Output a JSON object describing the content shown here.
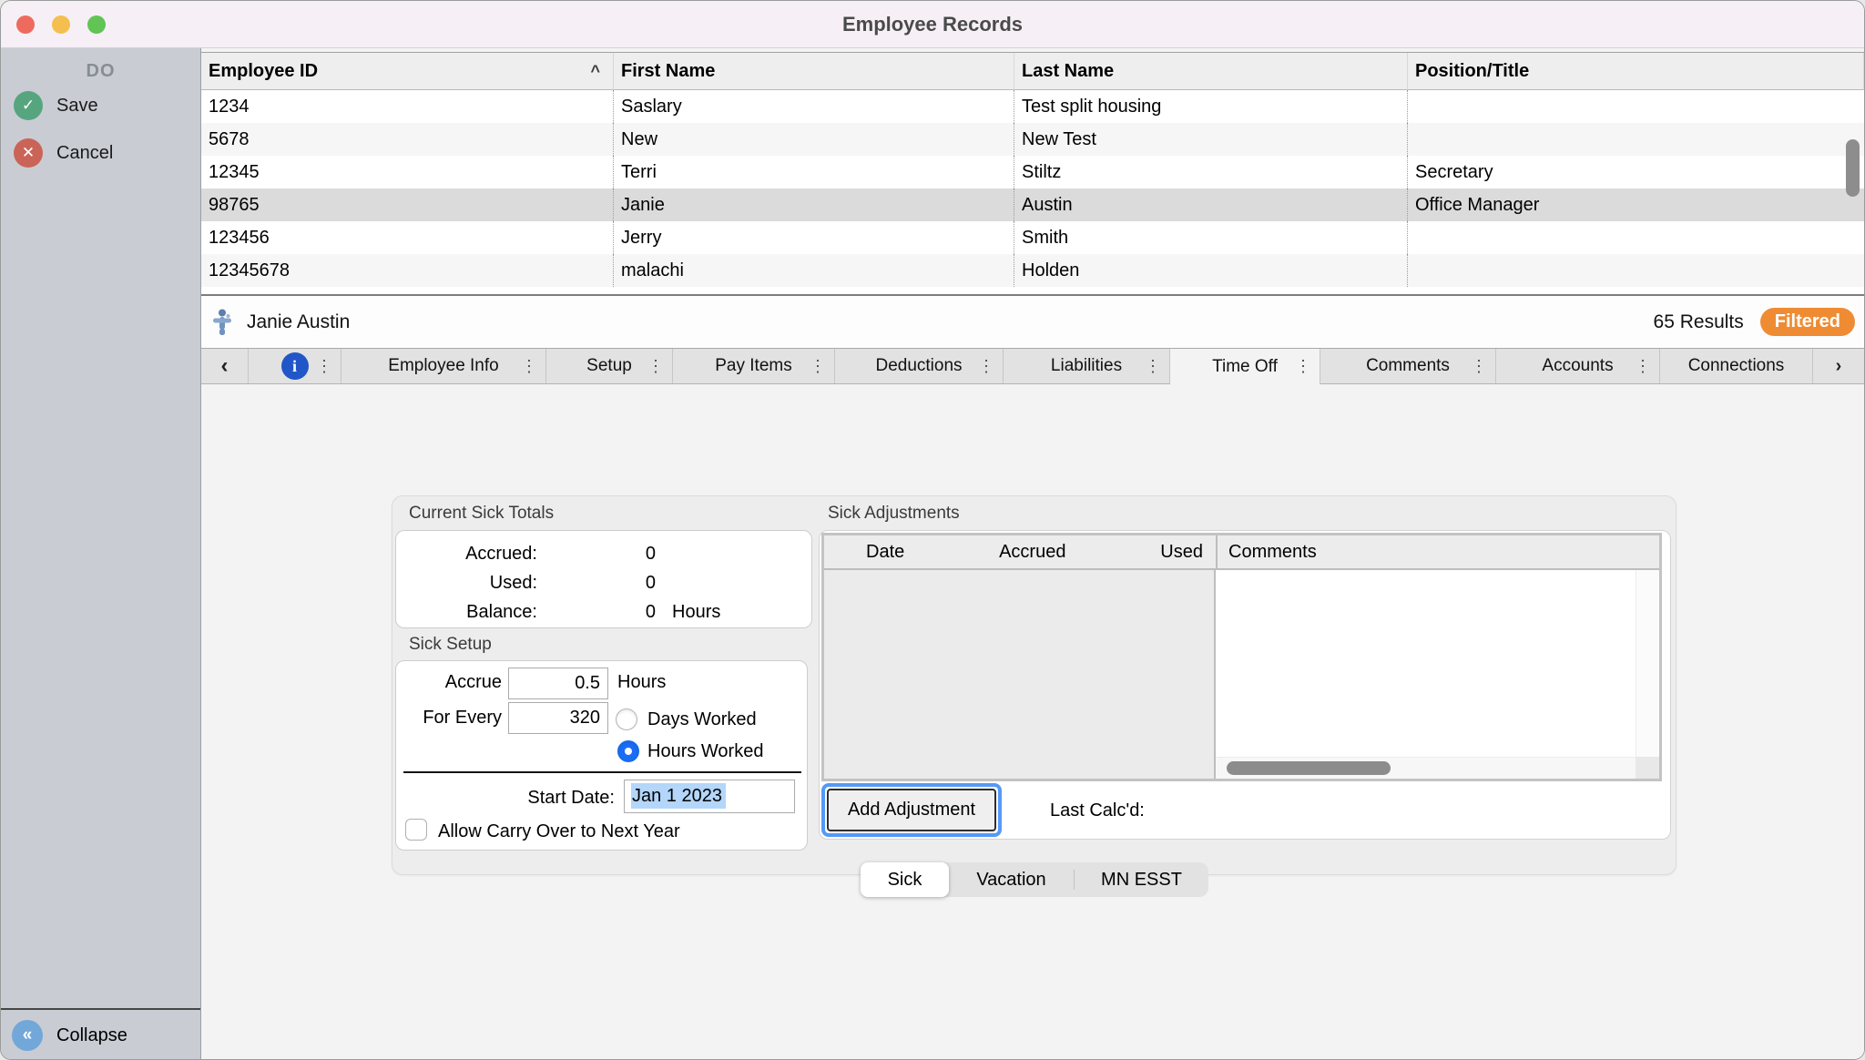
{
  "window": {
    "title": "Employee Records"
  },
  "sidebar": {
    "section_label": "DO",
    "save_label": "Save",
    "cancel_label": "Cancel",
    "collapse_label": "Collapse",
    "save_icon": "check-circle-icon",
    "cancel_icon": "x-circle-icon",
    "collapse_icon": "double-chevron-left-icon"
  },
  "employee_table": {
    "columns": [
      "Employee ID",
      "First Name",
      "Last Name",
      "Position/Title"
    ],
    "sort_caret": "^",
    "rows": [
      {
        "id": "1234",
        "first": "Saslary",
        "last": "Test split housing",
        "title": ""
      },
      {
        "id": "5678",
        "first": "New",
        "last": "New Test",
        "title": ""
      },
      {
        "id": "12345",
        "first": "Terri",
        "last": "Stiltz",
        "title": "Secretary"
      },
      {
        "id": "98765",
        "first": "Janie",
        "last": "Austin",
        "title": "Office Manager"
      },
      {
        "id": "123456",
        "first": "Jerry",
        "last": "Smith",
        "title": ""
      },
      {
        "id": "12345678",
        "first": "malachi",
        "last": "Holden",
        "title": ""
      }
    ],
    "selected_row_index": 3
  },
  "result_bar": {
    "selected_name": "Janie Austin",
    "results_count": "65 Results",
    "filter_badge": "Filtered",
    "badge_color": "#ef8c33"
  },
  "tabbar": {
    "back_glyph": "‹",
    "forward_glyph": "›",
    "menu_glyph": "⋮",
    "info_glyph": "i",
    "tabs": [
      {
        "label": "Employee Info"
      },
      {
        "label": "Setup"
      },
      {
        "label": "Pay Items"
      },
      {
        "label": "Deductions"
      },
      {
        "label": "Liabilities"
      },
      {
        "label": "Time Off"
      },
      {
        "label": "Comments"
      },
      {
        "label": "Accounts"
      },
      {
        "label": "Connections"
      }
    ],
    "selected_tab": "Time Off"
  },
  "time_off": {
    "totals": {
      "heading": "Current Sick Totals",
      "rows": [
        {
          "label": "Accrued:",
          "value": "0",
          "unit": ""
        },
        {
          "label": "Used:",
          "value": "0",
          "unit": ""
        },
        {
          "label": "Balance:",
          "value": "0",
          "unit": "Hours"
        }
      ]
    },
    "setup": {
      "heading": "Sick Setup",
      "accrue_label": "Accrue",
      "accrue_value": "0.5",
      "accrue_unit": "Hours",
      "for_every_label": "For Every",
      "for_every_value": "320",
      "radio_days_label": "Days Worked",
      "radio_hours_label": "Hours Worked",
      "selected_radio": "Hours Worked",
      "start_date_label": "Start Date:",
      "start_date_value": "Jan 1 2023",
      "carry_over_label": "Allow Carry Over to Next Year",
      "carry_over_checked": false
    },
    "adjustments": {
      "heading": "Sick Adjustments",
      "columns": [
        "Date",
        "Accrued",
        "Used",
        "Comments"
      ],
      "rows": [],
      "add_button_label": "Add Adjustment",
      "last_calcd_label": "Last Calc'd:"
    },
    "category_tabs": [
      {
        "label": "Sick"
      },
      {
        "label": "Vacation"
      },
      {
        "label": "MN ESST"
      }
    ],
    "selected_category": "Sick"
  },
  "colors": {
    "titlebar": "#f6f0f6",
    "sidebar": "#c9ccd3",
    "accent_blue": "#1a6df5",
    "filter_orange": "#ef8c33",
    "save_green": "#56a57f",
    "cancel_red": "#cb6458",
    "collapse_blue": "#72a7d9",
    "selection_highlight": "#b3d6fa",
    "focus_ring": "#5599f6"
  }
}
